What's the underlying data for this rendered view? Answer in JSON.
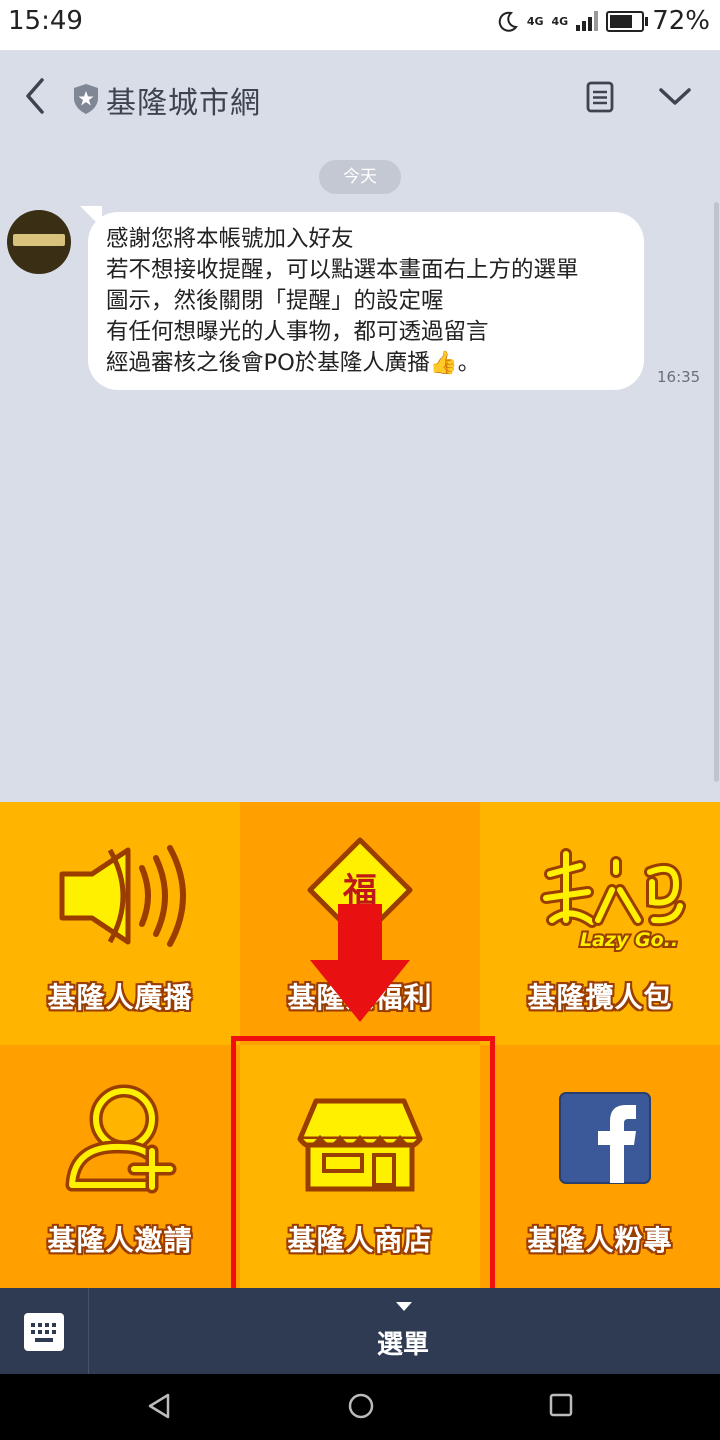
{
  "status_bar": {
    "time": "15:49",
    "network_a": "4G",
    "network_b": "4G",
    "battery_percent_text": "72%",
    "battery_level": 0.72
  },
  "header": {
    "title": "基隆城市網",
    "back_icon": "chevron-left-icon",
    "badge_icon": "official-shield-star-icon",
    "notes_icon": "notes-list-icon",
    "expand_icon": "chevron-down-icon"
  },
  "chat": {
    "date_divider": "今天",
    "messages": [
      {
        "sender_avatar": "keelung-avatar",
        "lines": [
          "感謝您將本帳號加入好友",
          "若不想接收提醒，可以點選本畫面右上方的選單",
          "圖示，然後關閉「提醒」的設定喔",
          "有任何想曝光的人事物，都可透過留言",
          "經過審核之後會PO於基隆人廣播👍。"
        ],
        "time": "16:35"
      }
    ]
  },
  "menu": {
    "items": [
      {
        "label": "基隆人廣播",
        "icon": "speaker-icon",
        "bg": "#FFB400"
      },
      {
        "label": "基隆人福利",
        "icon": "fu-diamond-icon",
        "bg": "#FFA000"
      },
      {
        "label": "基隆攬人包",
        "icon": "lazy-go-logo-icon",
        "bg": "#FFB400",
        "logo_text": "Lazy Go.."
      },
      {
        "label": "基隆人邀請",
        "icon": "add-person-icon",
        "bg": "#FFA000"
      },
      {
        "label": "基隆人商店",
        "icon": "shop-icon",
        "bg": "#FFB400"
      },
      {
        "label": "基隆人粉專",
        "icon": "facebook-icon",
        "bg": "#FFA000"
      }
    ],
    "fu_char": "福",
    "highlight_color": "#F01010"
  },
  "bottom_bar": {
    "keyboard_icon": "keyboard-icon",
    "menu_label": "選單",
    "menu_caret_icon": "caret-down-icon"
  },
  "nav": {
    "back": "nav-back-icon",
    "home": "nav-home-icon",
    "recents": "nav-recents-icon"
  }
}
